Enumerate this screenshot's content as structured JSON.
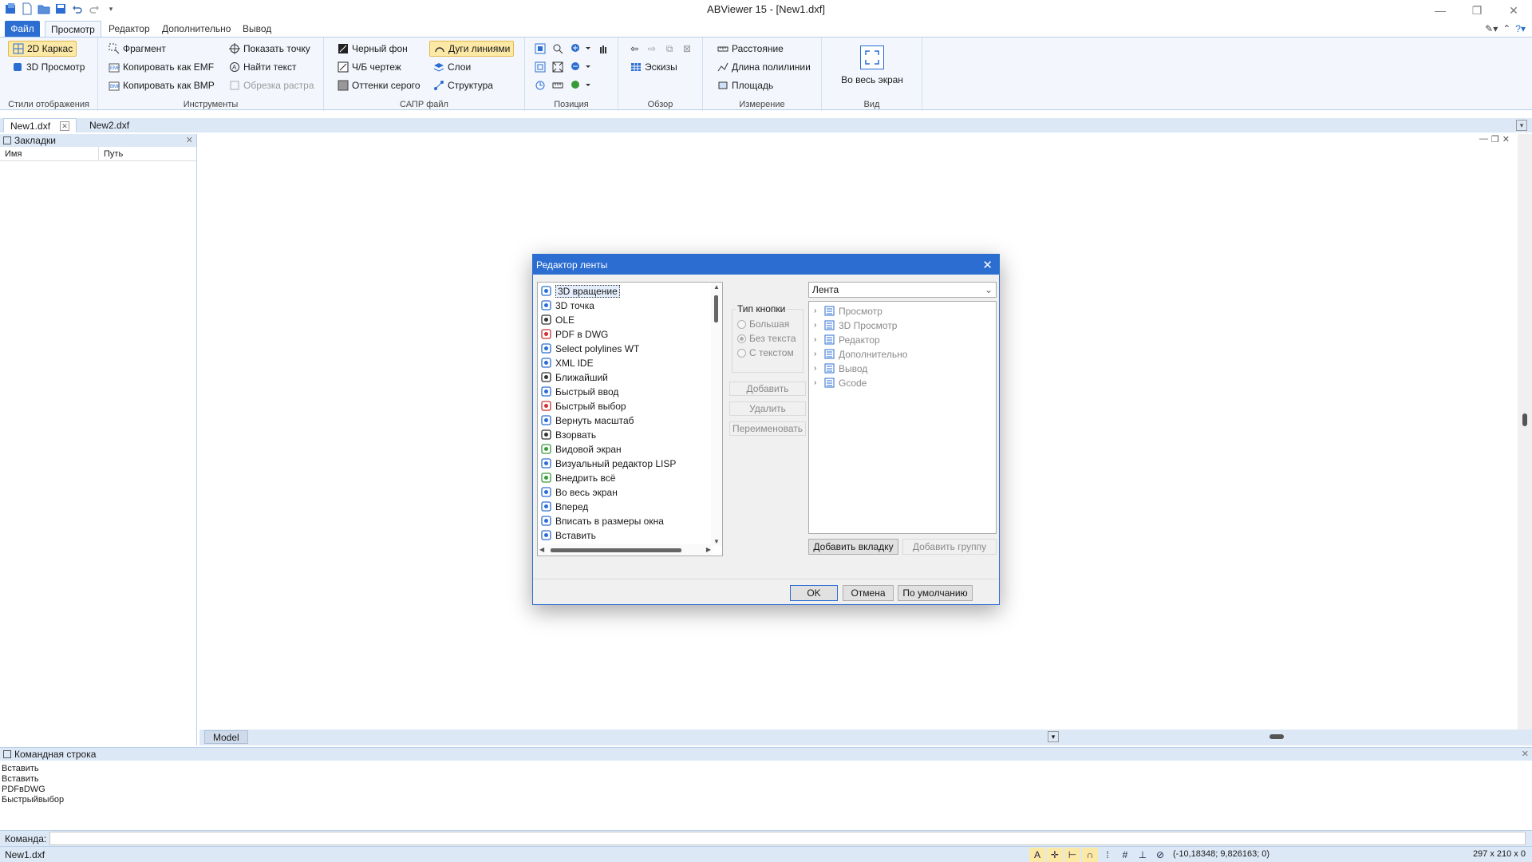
{
  "window": {
    "title": "ABViewer 15 - [New1.dxf]",
    "controls": [
      "minimize",
      "restore",
      "close"
    ]
  },
  "ribbon": {
    "file_tab": "Файл",
    "tabs": [
      "Просмотр",
      "Редактор",
      "Дополнительно",
      "Вывод"
    ],
    "active_tab": "Просмотр",
    "groups": {
      "display_styles": {
        "label": "Стили отображения",
        "buttons": [
          "2D Каркас",
          "3D Просмотр"
        ],
        "selected": "2D Каркас"
      },
      "tools": {
        "label": "Инструменты",
        "col1": [
          "Фрагмент",
          "Копировать как EMF",
          "Копировать как BMP"
        ],
        "col2": [
          "Показать точку",
          "Найти текст",
          "Обрезка растра"
        ],
        "disabled": "Обрезка растра"
      },
      "cad_file": {
        "label": "САПР файл",
        "col1": [
          "Черный фон",
          "Ч/Б чертеж",
          "Оттенки серого"
        ],
        "col2": [
          "Дуги линиями",
          "Слои",
          "Структура"
        ],
        "selected": "Дуги линиями"
      },
      "position": {
        "label": "Позиция"
      },
      "browse": {
        "label": "Обзор",
        "sketches": "Эскизы"
      },
      "measure": {
        "label": "Измерение",
        "buttons": [
          "Расстояние",
          "Длина полилинии",
          "Площадь"
        ]
      },
      "view": {
        "label": "Вид",
        "big_button": "Во весь экран"
      }
    }
  },
  "doc_tabs": [
    "New1.dxf",
    "New2.dxf"
  ],
  "bookmarks": {
    "title": "Закладки",
    "columns": [
      "Имя",
      "Путь"
    ]
  },
  "layout_tab": "Model",
  "command": {
    "title": "Командная строка",
    "log": [
      "Вставить",
      "Вставить",
      "PDFвDWG",
      "Быстрыйвыбор"
    ],
    "prompt": "Команда:"
  },
  "status": {
    "file": "New1.dxf",
    "coords": "(-10,18348; 9,826163; 0)",
    "size": "297 x 210 x 0"
  },
  "dialog": {
    "title": "Редактор ленты",
    "commands": [
      "3D вращение",
      "3D точка",
      "OLE",
      "PDF в DWG",
      "Select polylines WT",
      "XML IDE",
      "Ближайший",
      "Быстрый ввод",
      "Быстрый выбор",
      "Вернуть масштаб",
      "Взорвать",
      "Видовой экран",
      "Визуальный редактор LISP",
      "Внедрить всё",
      "Во весь экран",
      "Вперед",
      "Вписать в размеры окна",
      "Вставить"
    ],
    "selected_command": "3D вращение",
    "button_type": {
      "label": "Тип кнопки",
      "options": [
        "Большая",
        "Без текста",
        "С текстом"
      ],
      "selected": "Без текста"
    },
    "mid_buttons": [
      "Добавить",
      "Удалить",
      "Переименовать"
    ],
    "ribbon_select": "Лента",
    "tree": [
      "Просмотр",
      "3D Просмотр",
      "Редактор",
      "Дополнительно",
      "Вывод",
      "Gcode"
    ],
    "add_tab": "Добавить вкладку",
    "add_group": "Добавить группу",
    "ok": "OK",
    "cancel": "Отмена",
    "default": "По умолчанию"
  },
  "colors": {
    "accent": "#2b6dd1",
    "ribbon_bg": "#f3f7fd",
    "selected_bg": "#fde9a6",
    "panel_header": "#dde8f6"
  }
}
